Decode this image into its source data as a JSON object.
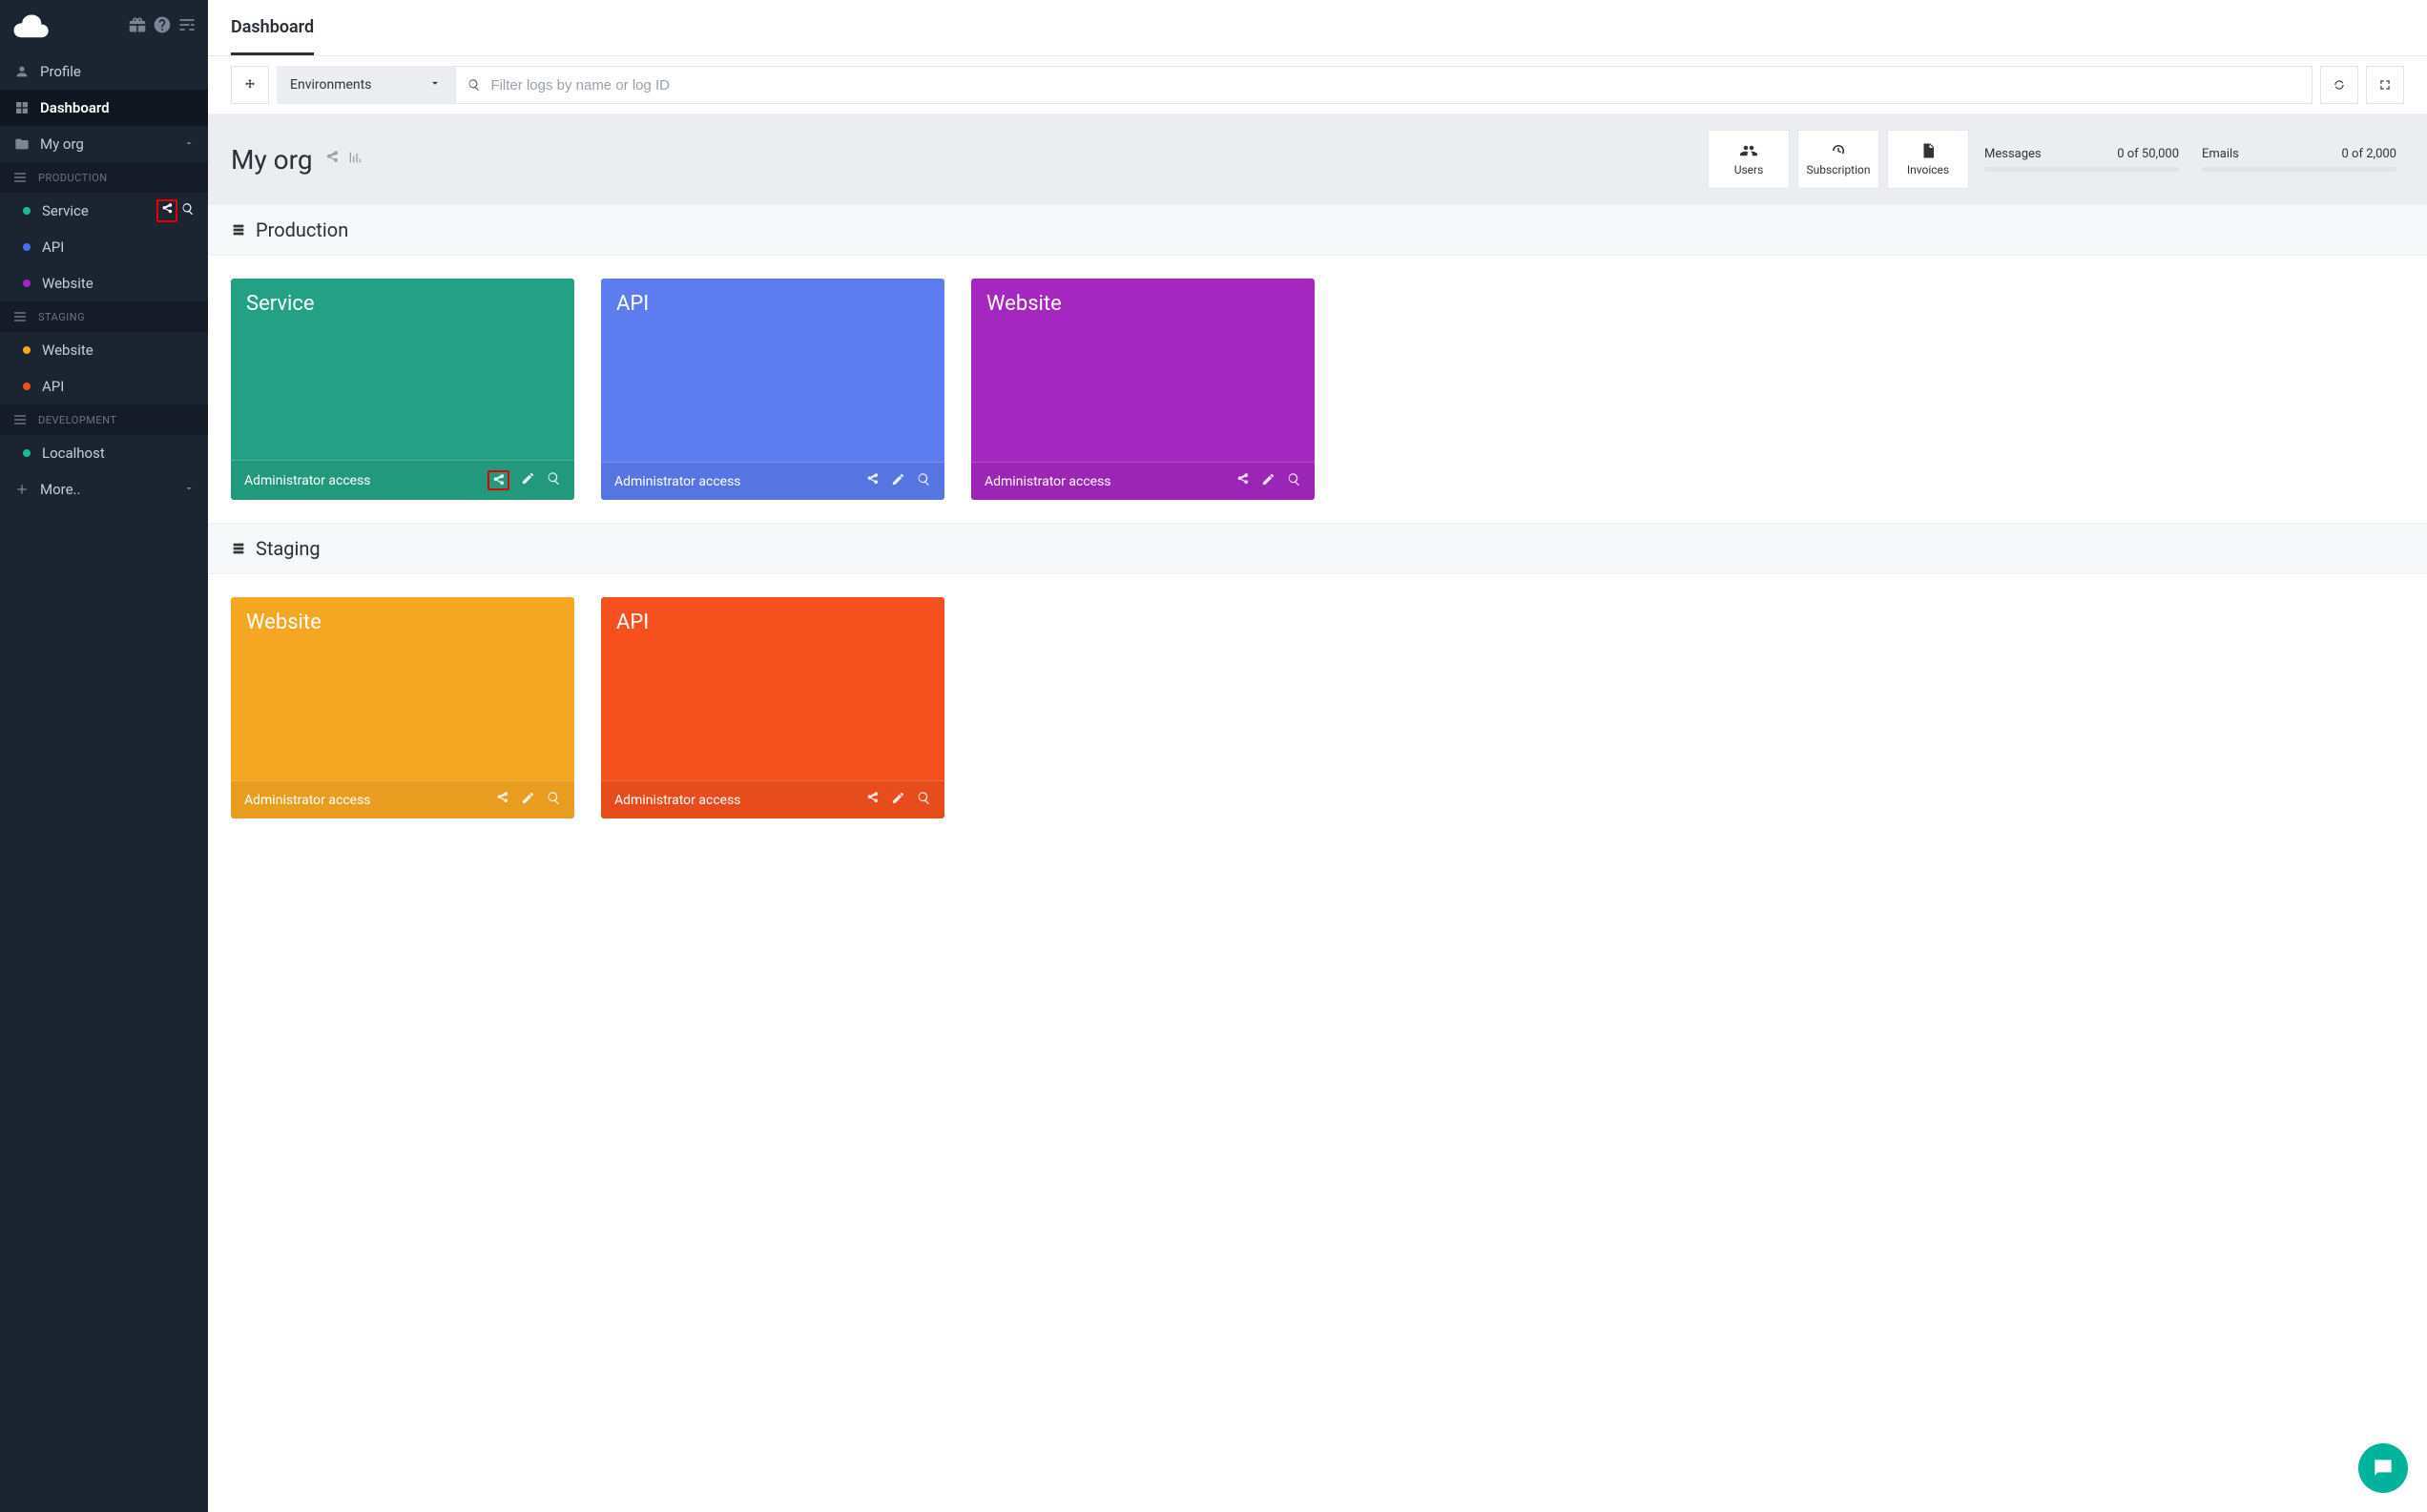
{
  "sidebar": {
    "nav": {
      "profile": "Profile",
      "dashboard": "Dashboard",
      "myorg": "My org",
      "more": "More.."
    },
    "sections": {
      "production": "PRODUCTION",
      "staging": "STAGING",
      "development": "DEVELOPMENT"
    },
    "items": {
      "prod_service": "Service",
      "prod_api": "API",
      "prod_website": "Website",
      "stag_website": "Website",
      "stag_api": "API",
      "dev_localhost": "Localhost"
    }
  },
  "tabs": {
    "dashboard": "Dashboard"
  },
  "toolbar": {
    "env_label": "Environments",
    "search_placeholder": "Filter logs by name or log ID"
  },
  "org": {
    "title": "My org",
    "actions": {
      "users": "Users",
      "subscription": "Subscription",
      "invoices": "Invoices"
    },
    "stats": {
      "messages_label": "Messages",
      "messages_value": "0 of 50,000",
      "emails_label": "Emails",
      "emails_value": "0 of 2,000"
    }
  },
  "sections": {
    "production": {
      "title": "Production",
      "cards": [
        {
          "name": "Service",
          "role": "Administrator access",
          "color": "c-teal",
          "highlight": true
        },
        {
          "name": "API",
          "role": "Administrator access",
          "color": "c-blue"
        },
        {
          "name": "Website",
          "role": "Administrator access",
          "color": "c-purple"
        }
      ]
    },
    "staging": {
      "title": "Staging",
      "cards": [
        {
          "name": "Website",
          "role": "Administrator access",
          "color": "c-orange"
        },
        {
          "name": "API",
          "role": "Administrator access",
          "color": "c-red"
        }
      ]
    }
  }
}
